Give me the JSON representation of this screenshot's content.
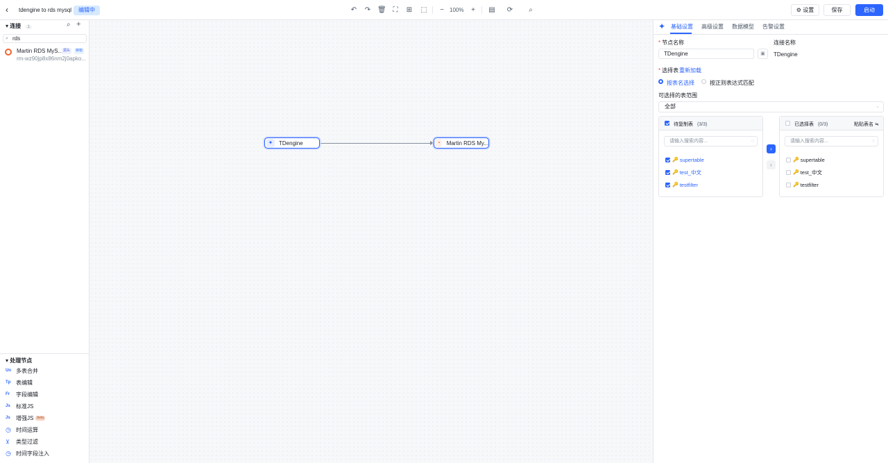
{
  "header": {
    "back_icon": "chevron-left-icon",
    "task_name": "tdengine to rds mysql",
    "status": "编辑中",
    "zoom": "100%",
    "settings_label": "设置",
    "save_label": "保存",
    "start_label": "启动"
  },
  "left": {
    "connections_title": "连接",
    "connections_count": "1",
    "search_value": "rds",
    "connection": {
      "name": "Martin RDS MyS...",
      "tag_source": "源头",
      "tag_target": "目标",
      "sub": "rm-wz90jp8x86nm2j0apko..."
    },
    "processing_title": "处理节点",
    "processing_items": [
      {
        "icon": "Un",
        "label": "多表合并"
      },
      {
        "icon": "Tp",
        "label": "表编辑"
      },
      {
        "icon": "Fr",
        "label": "字段编辑"
      },
      {
        "icon": "Js",
        "label": "标准JS"
      },
      {
        "icon": "Js",
        "label": "增强JS",
        "badge": "beta"
      },
      {
        "icon": "clock",
        "label": "时间运算"
      },
      {
        "icon": "filter",
        "label": "类型过滤"
      },
      {
        "icon": "clock",
        "label": "时间字段注入"
      }
    ]
  },
  "canvas": {
    "source_node": "TDengine",
    "target_node": "Martin RDS My..."
  },
  "panel": {
    "tabs": [
      "基础设置",
      "高级设置",
      "数据模型",
      "告警设置"
    ],
    "node_name_label": "节点名称",
    "node_name_value": "TDengine",
    "conn_name_label": "连接名称",
    "conn_name_value": "TDengine",
    "select_table_label": "选择表",
    "reload_label": "重新加载",
    "radio_by_name": "按表名选择",
    "radio_by_regex": "按正则表达式匹配",
    "range_label": "可选择的表范围",
    "range_value": "全部",
    "left_box": {
      "title": "待复制表",
      "count": "(3/3)",
      "search_placeholder": "请输入搜索内容...",
      "items": [
        "supertable",
        "test_中文",
        "testfilter"
      ]
    },
    "right_box": {
      "title": "已选择表",
      "count": "(0/3)",
      "paste_label": "粘贴表名",
      "search_placeholder": "请输入搜索内容...",
      "items": [
        "supertable",
        "test_中文",
        "testfilter"
      ]
    }
  },
  "colors": {
    "accent": "#2c65ff",
    "status_tag_bg": "#d6e9ff",
    "required": "#f53f3f"
  }
}
